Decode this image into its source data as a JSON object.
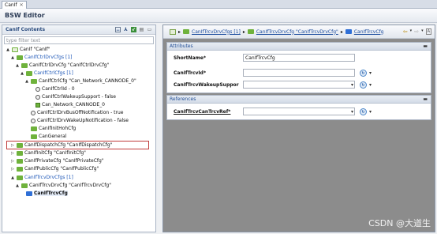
{
  "tab": {
    "label": "CanIf"
  },
  "editor": {
    "title": "BSW Editor"
  },
  "left": {
    "title": "CanIf Contents",
    "filter_placeholder": "type filter text",
    "tree": [
      {
        "label": "CanIf \"CanIf\"",
        "icon": "module",
        "twisty": "▲",
        "blue": false
      },
      {
        "label": "CanIfCtrlDrvCfgs [1]",
        "icon": "folder",
        "twisty": "▲",
        "blue": true
      },
      {
        "label": "CanIfCtrlDrvCfg \"CanIfCtrlDrvCfg\"",
        "icon": "folder",
        "twisty": "▲",
        "blue": false
      },
      {
        "label": "CanIfCtrlCfgs [1]",
        "icon": "folder",
        "twisty": "▲",
        "blue": true
      },
      {
        "label": "CanIfCtrlCfg \"Can_Network_CANNODE_0\"",
        "icon": "folder",
        "twisty": "▲",
        "blue": false
      },
      {
        "label": "CanIfCtrlId - 0",
        "icon": "gear",
        "twisty": "",
        "blue": false
      },
      {
        "label": "CanIfCtrlWakeupSupport - false",
        "icon": "gear",
        "twisty": "",
        "blue": false
      },
      {
        "label": "Can_Network_CANNODE_0",
        "icon": "check",
        "twisty": "",
        "blue": false
      },
      {
        "label": "CanIfCtrlDrvBusOffNotification - true",
        "icon": "gear",
        "twisty": "",
        "blue": false
      },
      {
        "label": "CanIfCtrlDrvWakeUpNotification - false",
        "icon": "gear",
        "twisty": "",
        "blue": false
      },
      {
        "label": "CanIfInitHohCfg",
        "icon": "folder",
        "twisty": "",
        "blue": false
      },
      {
        "label": "CanGeneral",
        "icon": "folder",
        "twisty": "",
        "blue": false
      },
      {
        "label": "CanIfDispatchCfg \"CanIfDispatchCfg\"",
        "icon": "folder",
        "twisty": "▷",
        "blue": false
      },
      {
        "label": "CanIfInitCfg \"CanIfInitCfg\"",
        "icon": "folder",
        "twisty": "▷",
        "blue": false
      },
      {
        "label": "CanIfPrivateCfg \"CanIfPrivateCfg\"",
        "icon": "folder",
        "twisty": "▷",
        "blue": false
      },
      {
        "label": "CanIfPublicCfg \"CanIfPublicCfg\"",
        "icon": "folder",
        "twisty": "▷",
        "blue": false
      },
      {
        "label": "CanIfTrcvDrvCfgs [1]",
        "icon": "folder",
        "twisty": "▲",
        "blue": true
      },
      {
        "label": "CanIfTrcvDrvCfg \"CanIfTrcvDrvCfg\"",
        "icon": "folder",
        "twisty": "▲",
        "blue": false
      },
      {
        "label": "CanIfTrcvCfg",
        "icon": "folder-blue",
        "twisty": "",
        "blue": false
      }
    ]
  },
  "breadcrumb": {
    "items": [
      "CanIfTrcvDrvCfgs [1]",
      "CanIfTrcvDrvCfg \"CanIfTrcvDrvCfg\"",
      "CanIfTrcvCfg"
    ]
  },
  "attributes": {
    "title": "Attributes",
    "fields": [
      {
        "label": "ShortName*",
        "value": "CanIfTrcvCfg"
      },
      {
        "label": "CanIfTrcvId*",
        "value": ""
      },
      {
        "label": "CanIfTrcvWakeupSuppor",
        "value": ""
      }
    ]
  },
  "references": {
    "title": "References",
    "fields": [
      {
        "label": "CanIfTrcvCanTrcvRef*",
        "value": ""
      }
    ]
  },
  "watermark": "CSDN @大道生",
  "colors": {
    "tree_blue": "#1f58b8",
    "folder_green": "#6fb23c",
    "selection_red": "#c03a3a"
  }
}
